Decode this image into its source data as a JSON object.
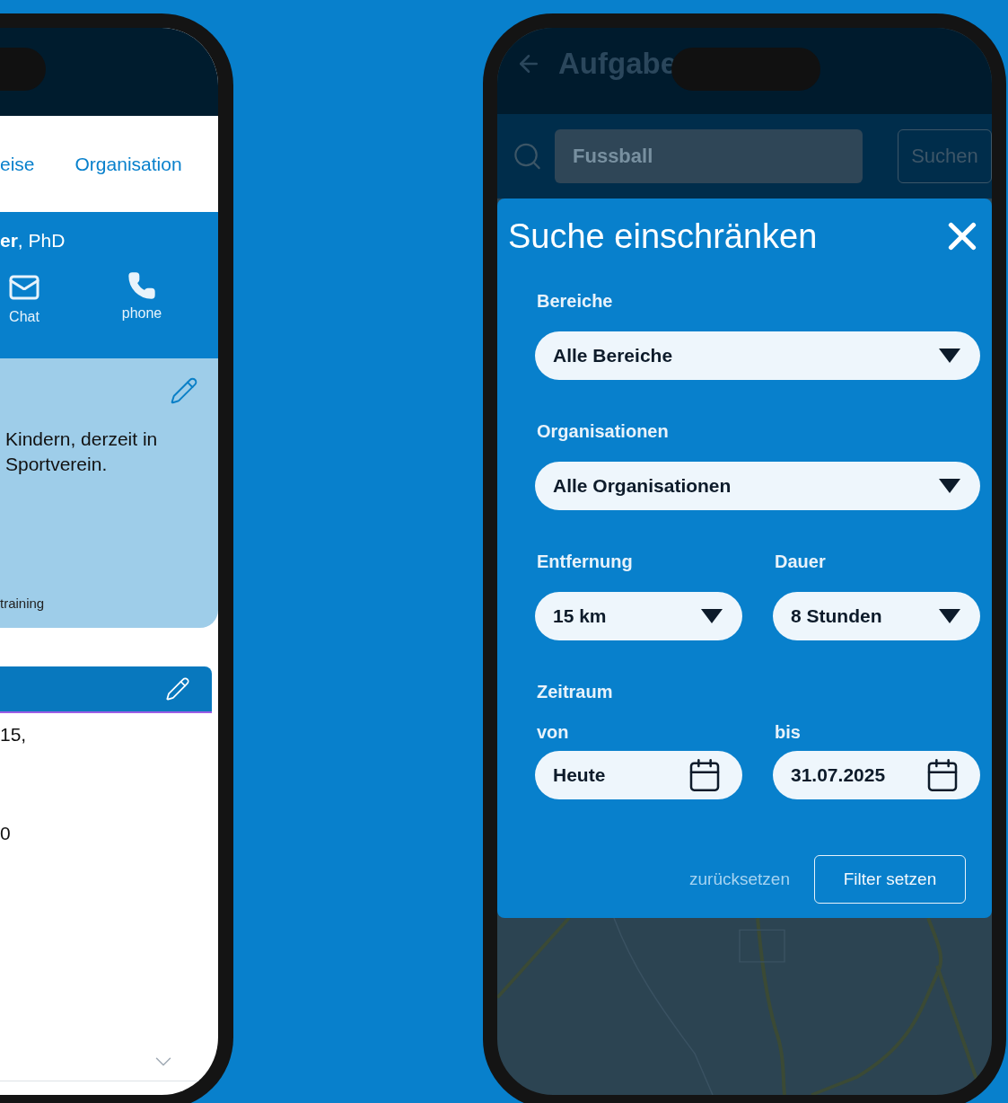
{
  "left_phone": {
    "tabs": [
      {
        "label": "eise"
      },
      {
        "label": "Organisation"
      }
    ],
    "profile": {
      "name": "**er**, PhD",
      "actions": [
        {
          "kind": "mail",
          "label": "Chat"
        },
        {
          "kind": "phone",
          "label": "phone"
        }
      ]
    },
    "about_card": {
      "text": "Kindern, derzeit in\nSportverein.",
      "footnote": "training"
    },
    "details": {
      "lines": [
        "15,",
        "0"
      ]
    }
  },
  "right_phone": {
    "header": {
      "title": "Aufgabe"
    },
    "search": {
      "value": "Fussball",
      "button": "Suchen"
    },
    "filter_dialog": {
      "title": "Suche einschränken",
      "rows": [
        [
          {
            "label": "Bereiche",
            "value": "Alle Bereiche"
          }
        ],
        [
          {
            "label": "Organisationen",
            "value": "Alle Organisationen"
          }
        ],
        [
          {
            "label": "Entfernung",
            "value": "15 km"
          },
          {
            "label": "Dauer",
            "value": "8 Stunden"
          }
        ]
      ],
      "period": {
        "label": "Zeitraum",
        "from": {
          "label": "von",
          "value": "Heute"
        },
        "to": {
          "label": "bis",
          "value": "31.07.2025"
        }
      },
      "reset": "zurücksetzen",
      "apply": "Filter setzen"
    }
  }
}
